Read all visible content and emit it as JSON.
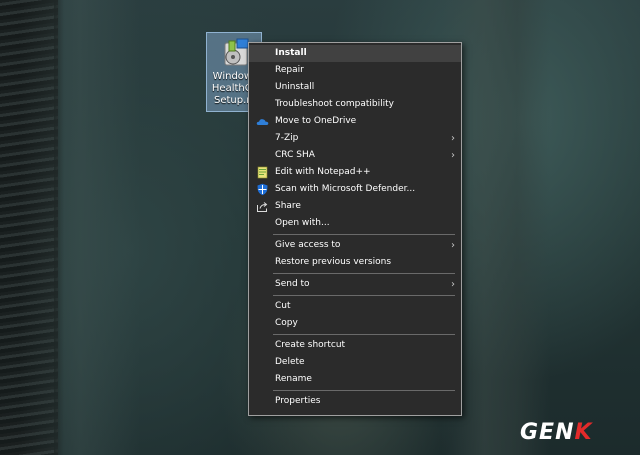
{
  "desktop_icon": {
    "label_line1": "Windows",
    "label_line2": "HealthCh",
    "label_line3": "Setup.m",
    "icon": "installer-package-icon"
  },
  "context_menu": {
    "items": [
      {
        "label": "Install",
        "bold": true
      },
      {
        "label": "Repair"
      },
      {
        "label": "Uninstall"
      },
      {
        "label": "Troubleshoot compatibility"
      },
      {
        "label": "Move to OneDrive",
        "icon": "onedrive-cloud-icon"
      },
      {
        "label": "7-Zip",
        "submenu": true
      },
      {
        "label": "CRC SHA",
        "submenu": true
      },
      {
        "label": "Edit with Notepad++",
        "icon": "notepad-plus-plus-icon"
      },
      {
        "label": "Scan with Microsoft Defender...",
        "icon": "defender-shield-icon"
      },
      {
        "label": "Share",
        "icon": "share-icon"
      },
      {
        "label": "Open with..."
      },
      {
        "label": "Give access to",
        "submenu": true
      },
      {
        "label": "Restore previous versions"
      },
      {
        "label": "Send to",
        "submenu": true
      },
      {
        "label": "Cut"
      },
      {
        "label": "Copy"
      },
      {
        "label": "Create shortcut"
      },
      {
        "label": "Delete"
      },
      {
        "label": "Rename"
      },
      {
        "label": "Properties"
      }
    ],
    "submenu_arrow": "›"
  },
  "watermark": {
    "text_main": "GEN",
    "text_accent": "K"
  },
  "colors": {
    "menu_bg": "#2b2b2b",
    "menu_border": "#a0a0a0",
    "highlight": "#414141",
    "onedrive_blue": "#2f7fd8",
    "defender_blue": "#1e6fd9",
    "logo_red": "#e22a2a"
  }
}
